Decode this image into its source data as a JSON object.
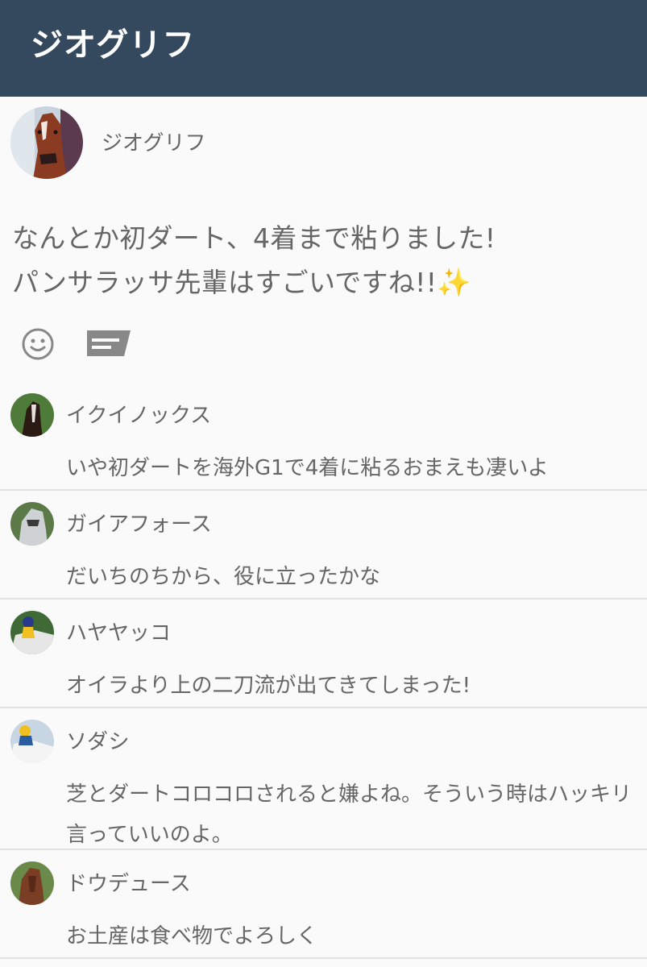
{
  "app_bar": {
    "title": "ジオグリフ"
  },
  "post": {
    "author": "ジオグリフ",
    "avatar_icon": "horse-avatar",
    "body_lines": [
      "なんとか初ダート、4着まで粘りました!",
      "パンサラッサ先輩はすごいですね!!"
    ],
    "emoji": "✨",
    "reaction_icon": "smile-icon",
    "reply_icon": "comment-icon"
  },
  "comments": [
    {
      "author": "イクイノックス",
      "text": "いや初ダートを海外G1で4着に粘るおまえも凄いよ"
    },
    {
      "author": "ガイアフォース",
      "text": "だいちのちから、役に立ったかな"
    },
    {
      "author": "ハヤヤッコ",
      "text": "オイラより上の二刀流が出てきてしまった!"
    },
    {
      "author": "ソダシ",
      "text": "芝とダートコロコロされると嫌よね。そういう時はハッキリ言っていいのよ。"
    },
    {
      "author": "ドウデュース",
      "text": "お土産は食べ物でよろしく"
    }
  ],
  "colors": {
    "app_bar_bg": "#34495e",
    "app_bar_text": "#ffffff",
    "background": "#fafafa",
    "text": "#666666",
    "divider": "#e2e2e2",
    "icon": "#888888"
  }
}
